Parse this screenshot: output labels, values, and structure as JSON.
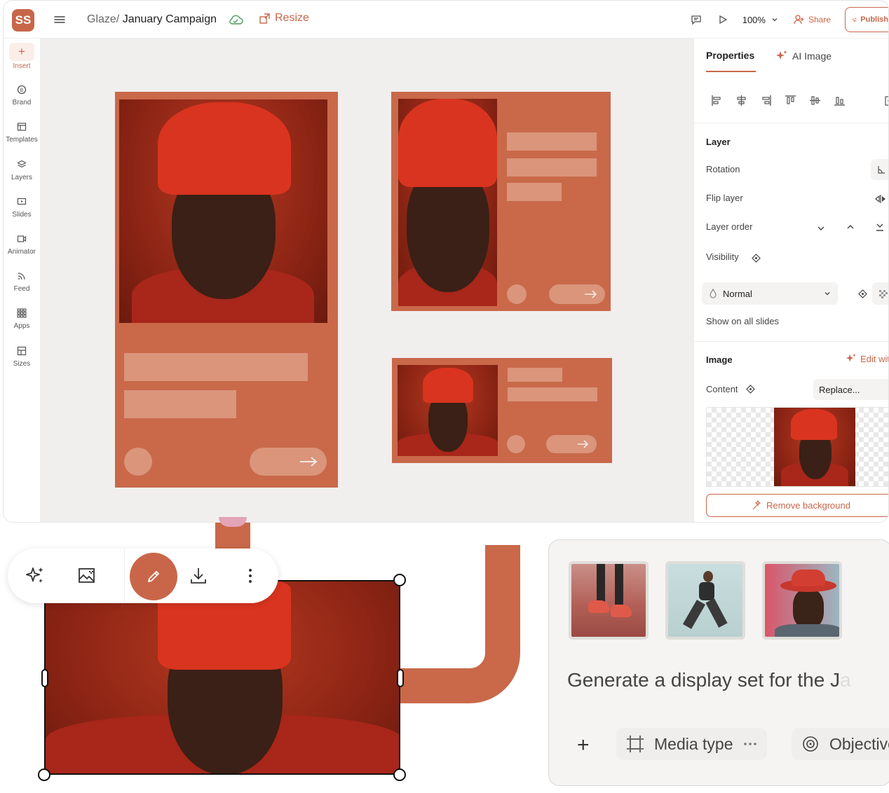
{
  "app": {
    "logo": "SS",
    "breadcrumb_workspace": "Glaze/",
    "document_title": "January Campaign",
    "resize_label": "Resize",
    "zoom_label": "100%",
    "share_label": "Share",
    "publish_label": "Publish"
  },
  "sidebar": {
    "items": [
      {
        "label": "Insert",
        "icon": "plus-icon"
      },
      {
        "label": "Brand",
        "icon": "brand-icon"
      },
      {
        "label": "Templates",
        "icon": "templates-icon"
      },
      {
        "label": "Layers",
        "icon": "layers-icon"
      },
      {
        "label": "Slides",
        "icon": "slides-icon"
      },
      {
        "label": "Animator",
        "icon": "animator-icon"
      },
      {
        "label": "Feed",
        "icon": "feed-icon"
      },
      {
        "label": "Apps",
        "icon": "apps-icon"
      },
      {
        "label": "Sizes",
        "icon": "sizes-icon"
      }
    ]
  },
  "properties": {
    "tab_properties": "Properties",
    "tab_ai_image": "AI Image",
    "layer_heading": "Layer",
    "rotation": "Rotation",
    "flip_layer": "Flip layer",
    "layer_order": "Layer order",
    "visibility": "Visibility",
    "blend_mode": "Normal",
    "show_on_all_slides": "Show on all slides",
    "image_heading": "Image",
    "edit_with": "Edit with",
    "content_label": "Content",
    "replace": "Replace...",
    "remove_background": "Remove background"
  },
  "generator": {
    "prompt_text": "Generate a display set for the J",
    "prompt_faded": "a",
    "media_type": "Media type",
    "objective": "Objective"
  },
  "colors": {
    "brand": "#c9664a",
    "card": "#c9694a",
    "placeholder": "#dd9d84"
  }
}
